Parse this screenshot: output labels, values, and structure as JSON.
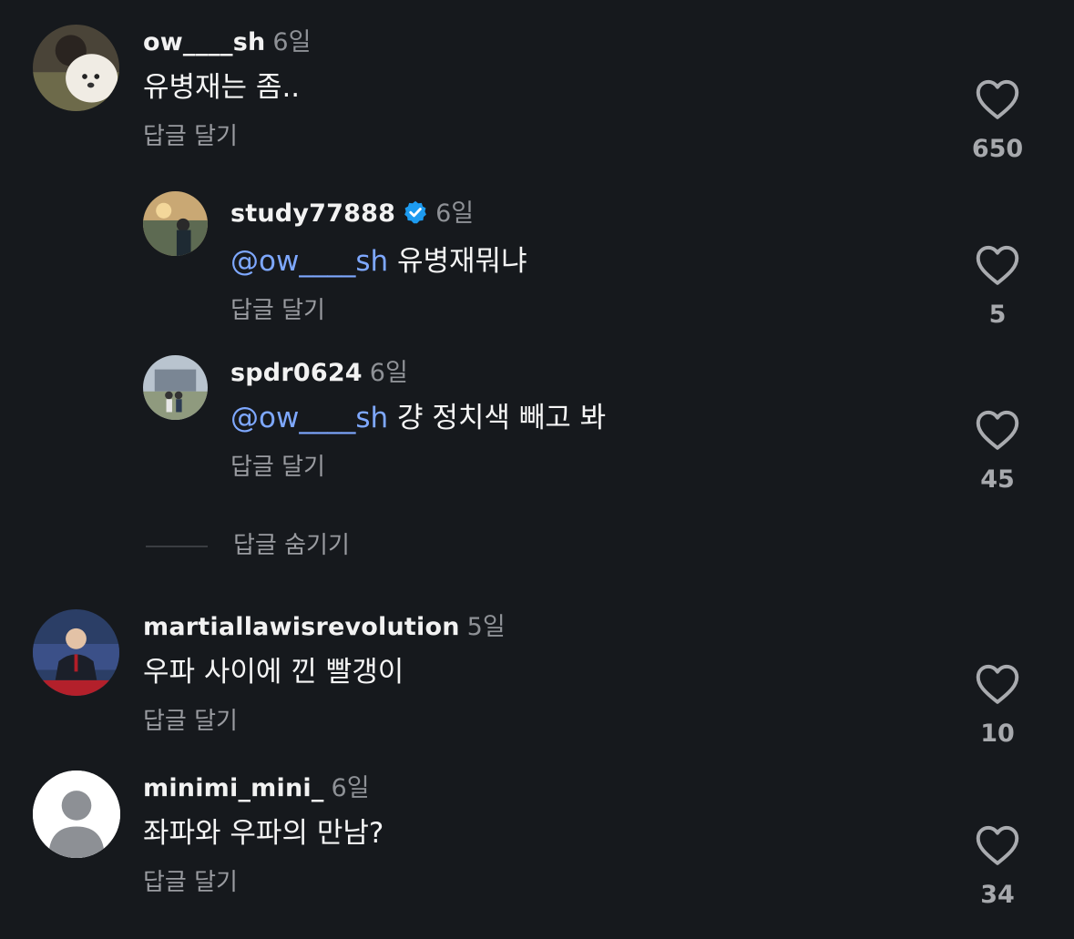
{
  "comments": [
    {
      "user": "ow____sh",
      "time": "6일",
      "text": "유병재는 좀..",
      "reply": "답글 달기",
      "likes": "650",
      "avatar": "dog-photo"
    },
    {
      "user": "study77888",
      "verified": true,
      "time": "6일",
      "mention": "@ow____sh",
      "text": "유병재뭐냐",
      "reply": "답글 달기",
      "likes": "5",
      "avatar": "sunset-photo"
    },
    {
      "user": "spdr0624",
      "time": "6일",
      "mention": "@ow____sh",
      "text": "걍 정치색 빼고 봐",
      "reply": "답글 달기",
      "likes": "45",
      "avatar": "building-photo"
    },
    {
      "user": "martiallawisrevolution",
      "time": "5일",
      "text": "우파 사이에 낀 빨갱이",
      "reply": "답글 달기",
      "likes": "10",
      "avatar": "speaker-photo"
    },
    {
      "user": "minimi_mini_",
      "time": "6일",
      "text": "좌파와 우파의 만남?",
      "reply": "답글 달기",
      "likes": "34",
      "avatar": "default-avatar"
    }
  ],
  "hide_replies": "답글 숨기기",
  "colors": {
    "background": "#16191d",
    "mention": "#7ea8ff",
    "muted": "#8e9196",
    "verified": "#1d9bf0"
  }
}
